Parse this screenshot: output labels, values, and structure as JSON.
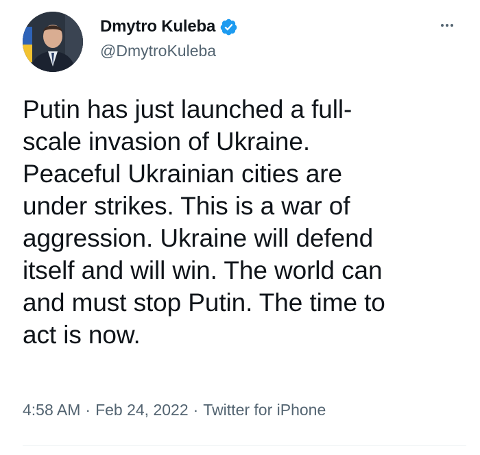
{
  "author": {
    "display_name": "Dmytro Kuleba",
    "handle": "@DmytroKuleba",
    "verified_icon": "verified-badge-icon",
    "avatar_icon": "avatar"
  },
  "tweet": {
    "lines": [
      "Putin has just launched a full-",
      "scale invasion of Ukraine.",
      "Peaceful Ukrainian cities are",
      "under strikes. This is a war of",
      "aggression. Ukraine will defend",
      "itself and will win. The world can",
      "and must stop Putin. The time to",
      "act is now."
    ],
    "time": "4:58 AM",
    "separator": "·",
    "date": "Feb 24, 2022",
    "source": "Twitter for iPhone"
  },
  "icons": {
    "more": "more-options-icon"
  },
  "colors": {
    "text_primary": "#0f1419",
    "text_secondary": "#536471",
    "verified_blue": "#1d9bf0",
    "divider": "#eff3f4"
  }
}
